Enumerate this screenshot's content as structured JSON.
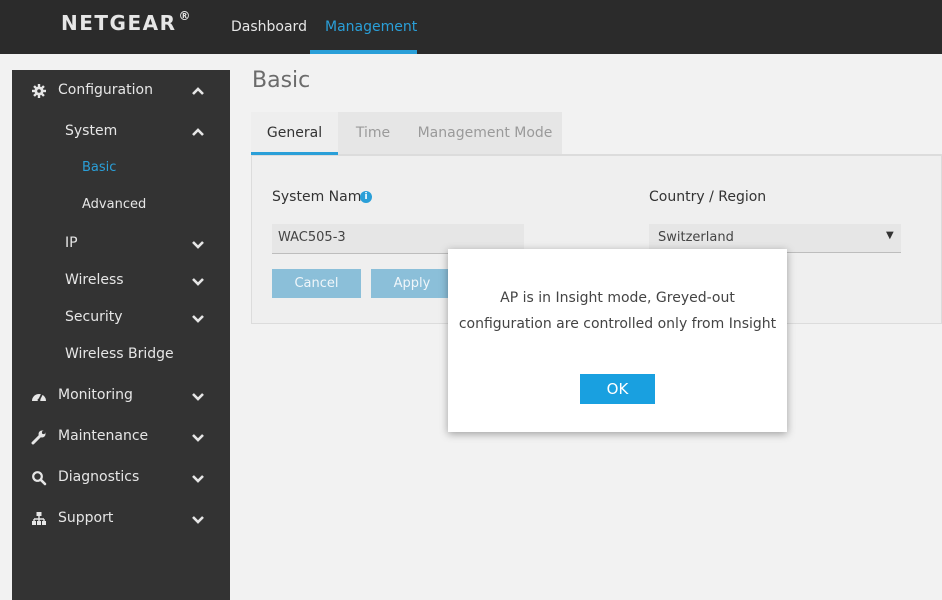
{
  "header": {
    "logo": "NETGEAR",
    "logo_mark": "®",
    "nav": [
      {
        "label": "Dashboard"
      },
      {
        "label": "Management"
      }
    ]
  },
  "sidebar": {
    "configuration": {
      "label": "Configuration",
      "icon": "gear-icon"
    },
    "system": {
      "label": "System"
    },
    "basic": {
      "label": "Basic"
    },
    "advanced": {
      "label": "Advanced"
    },
    "ip": {
      "label": "IP"
    },
    "wireless": {
      "label": "Wireless"
    },
    "security": {
      "label": "Security"
    },
    "wireless_bridge": {
      "label": "Wireless Bridge"
    },
    "monitoring": {
      "label": "Monitoring",
      "icon": "gauge-icon"
    },
    "maintenance": {
      "label": "Maintenance",
      "icon": "wrench-icon"
    },
    "diagnostics": {
      "label": "Diagnostics",
      "icon": "search-icon"
    },
    "support": {
      "label": "Support",
      "icon": "sitemap-icon"
    }
  },
  "main": {
    "title": "Basic",
    "tabs": [
      {
        "label": "General"
      },
      {
        "label": "Time"
      },
      {
        "label": "Management Mode"
      }
    ],
    "system_name": {
      "label": "System Name",
      "value": "WAC505-3"
    },
    "country": {
      "label": "Country / Region",
      "value": "Switzerland"
    },
    "cancel_label": "Cancel",
    "apply_label": "Apply"
  },
  "modal": {
    "line1": "AP is in Insight mode, Greyed-out",
    "line2": "configuration are controlled only from Insight",
    "ok_label": "OK"
  },
  "colors": {
    "accent": "#2a9fd8",
    "topbar": "#2b2b2b",
    "sidebar": "#333333",
    "ok_button": "#19a0e0"
  }
}
